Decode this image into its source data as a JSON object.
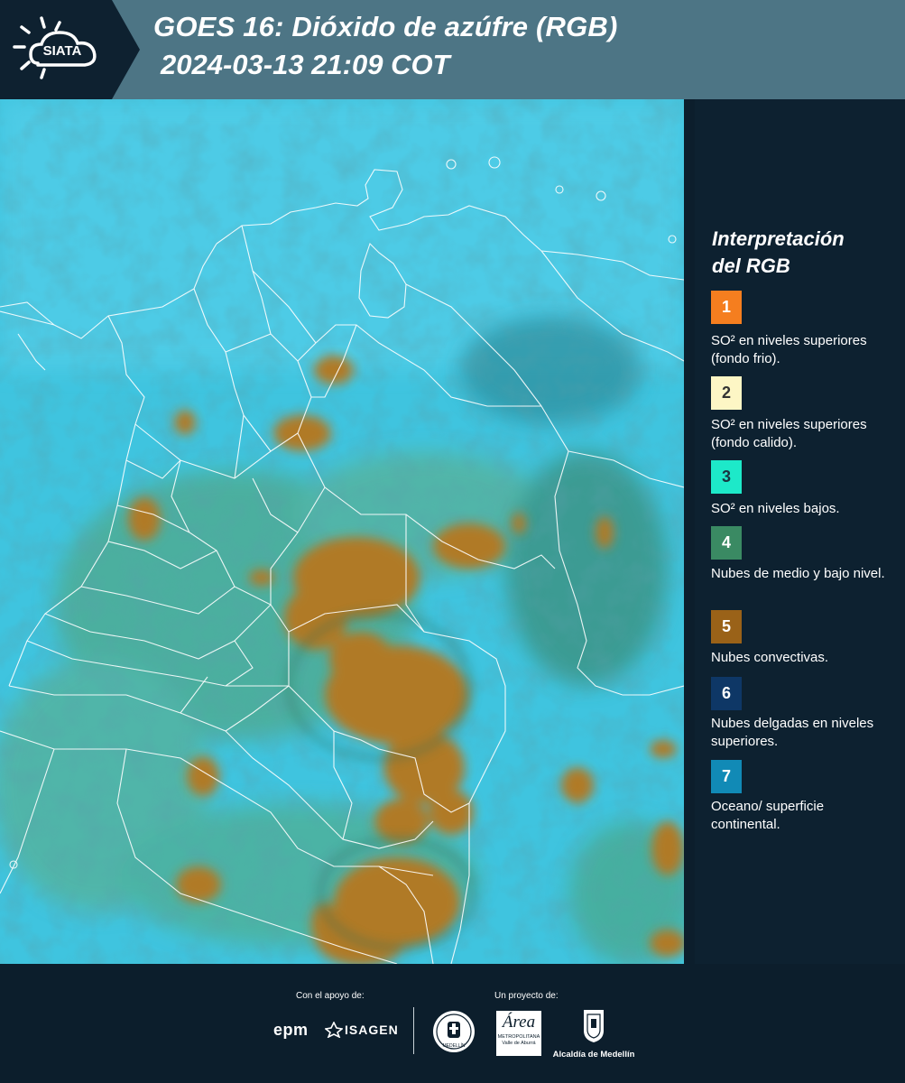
{
  "header": {
    "logo_text": "SIATA",
    "title_line1": "GOES 16: Dióxido de azúfre (RGB)",
    "title_line2": "2024-03-13 21:09 COT"
  },
  "legend": {
    "title_line1": "Interpretación",
    "title_line2": "del RGB",
    "items": [
      {
        "number": "1",
        "color": "#f57e1f",
        "text_color": "#ffffff",
        "label": "SO² en niveles superiores (fondo frio)."
      },
      {
        "number": "2",
        "color": "#fdf6c5",
        "text_color": "#333333",
        "label": "SO² en niveles superiores (fondo calido)."
      },
      {
        "number": "3",
        "color": "#1de9c9",
        "text_color": "#1a3340",
        "label": "SO² en niveles bajos."
      },
      {
        "number": "4",
        "color": "#3a8a63",
        "text_color": "#ffffff",
        "label": "Nubes de medio y bajo nivel."
      },
      {
        "number": "5",
        "color": "#9a6218",
        "text_color": "#ffffff",
        "label": "Nubes convectivas."
      },
      {
        "number": "6",
        "color": "#0e3766",
        "text_color": "#ffffff",
        "label": "Nubes delgadas en niveles superiores."
      },
      {
        "number": "7",
        "color": "#118ab6",
        "text_color": "#ffffff",
        "label": "Oceano/ superficie continental."
      }
    ]
  },
  "footer": {
    "support_label": "Con el apoyo de:",
    "project_label": "Un proyecto de:",
    "partner_epm": "epm",
    "partner_isagen": "ISAGEN",
    "partner_area_name": "Área",
    "partner_area_sub1": "METROPOLITANA",
    "partner_area_sub2": "Valle de Aburrá",
    "partner_alcaldia": "Alcaldía de Medellín",
    "seal_text": "MEDELLÍN"
  },
  "colors": {
    "header_bg": "#4d7585",
    "dark_bg": "#0c1e2c",
    "ocean": "#3fc4df",
    "convective": "#b07a28",
    "border_lines": "#ffffff"
  }
}
